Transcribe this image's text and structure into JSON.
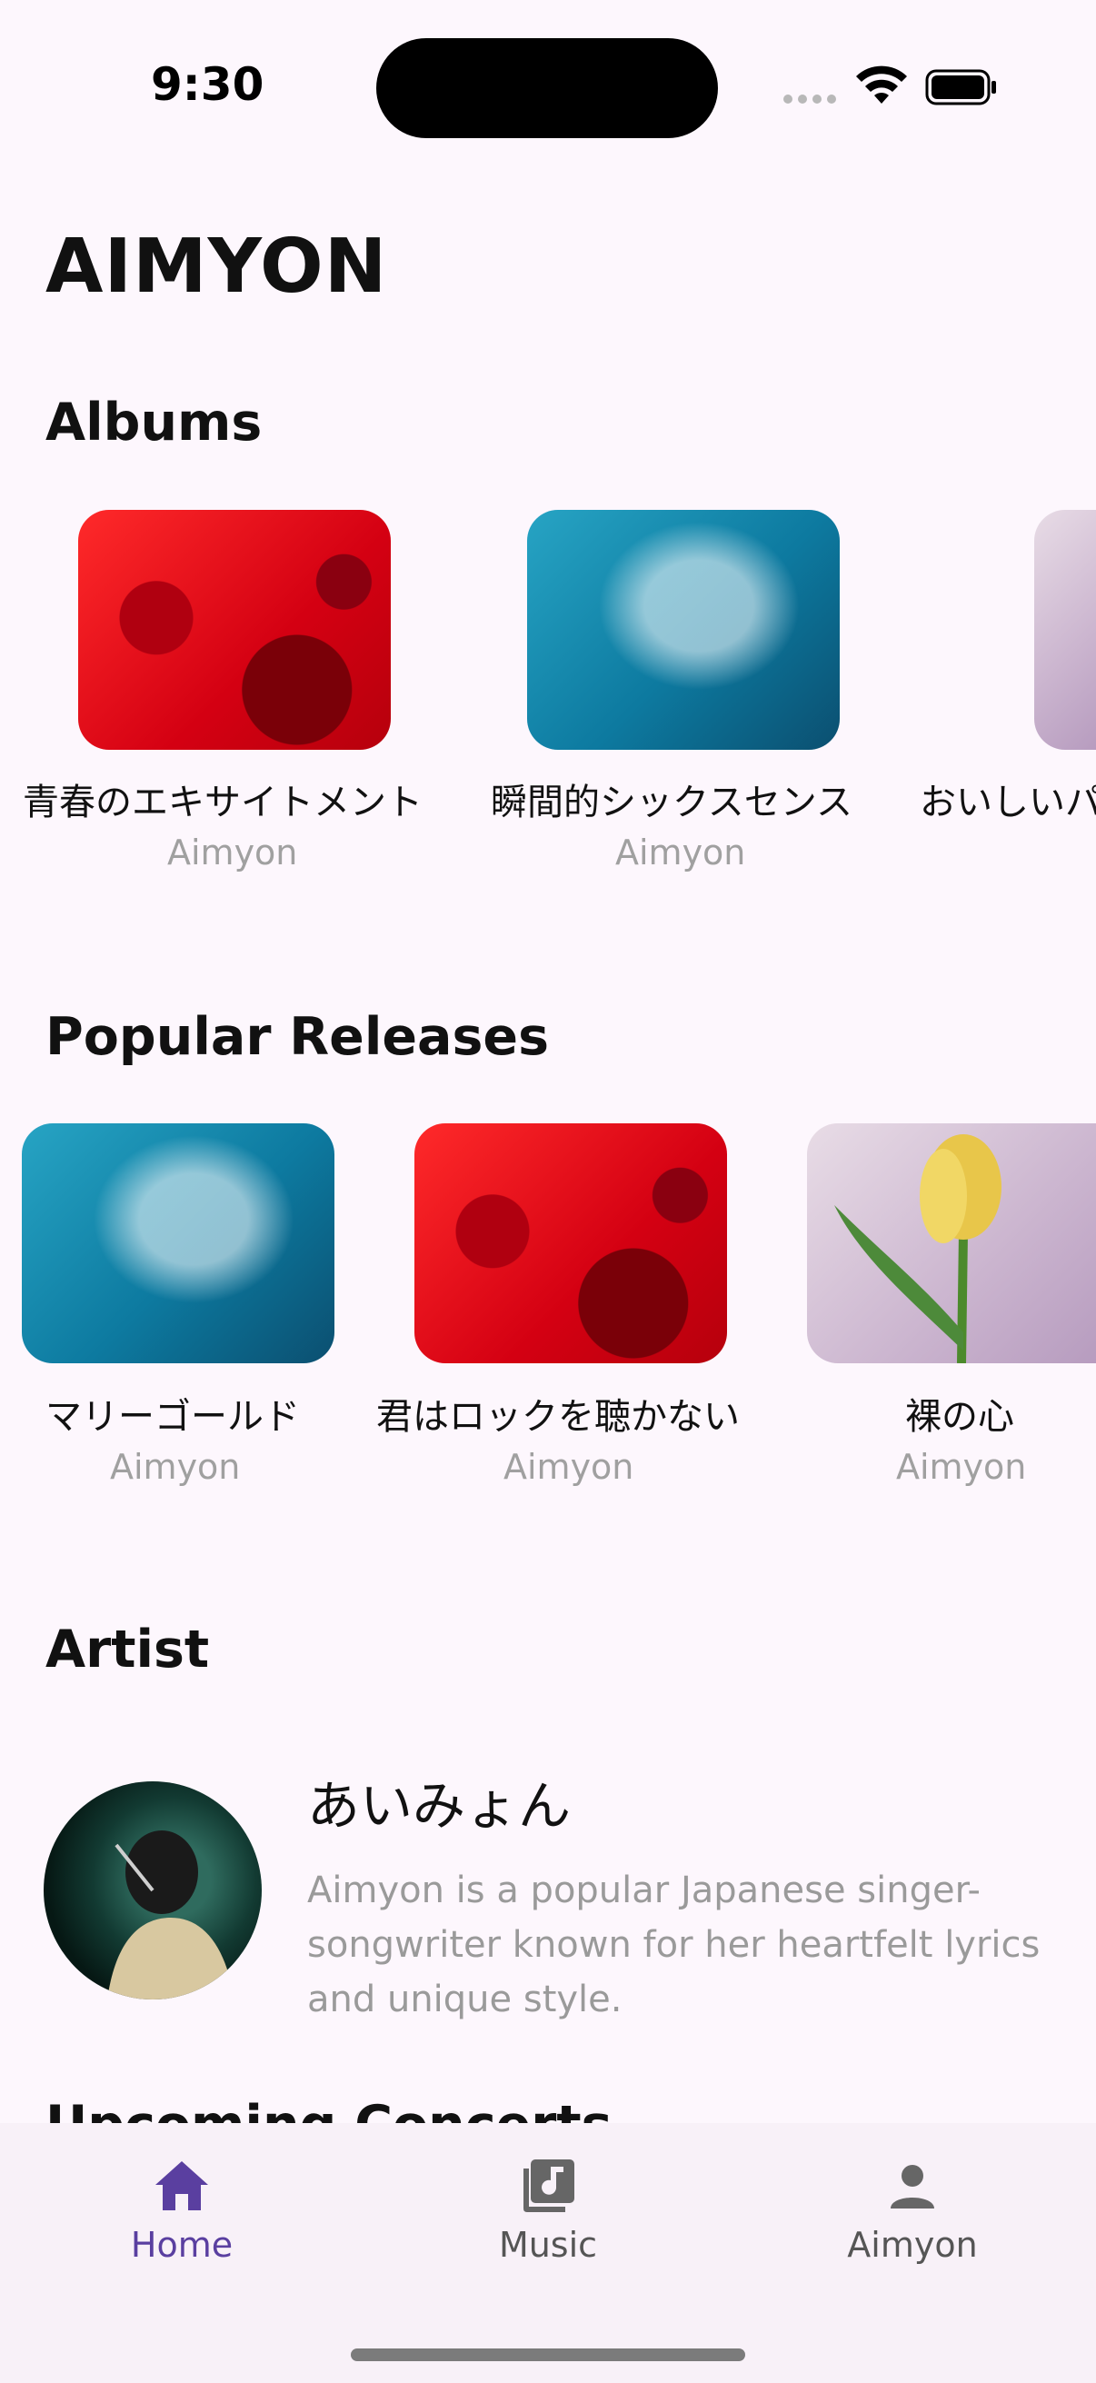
{
  "status_bar": {
    "time": "9:30"
  },
  "app_title": "AIMYON",
  "sections": {
    "albums": "Albums",
    "popular": "Popular Releases",
    "artist": "Artist",
    "concerts": "Upcoming Concerts"
  },
  "albums": [
    {
      "title": "青春のエキサイトメント",
      "artist": "Aimyon"
    },
    {
      "title": "瞬間的シックスセンス",
      "artist": "Aimyon"
    },
    {
      "title": "おいしいパ"
    }
  ],
  "popular_releases": [
    {
      "title": "マリーゴールド",
      "artist": "Aimyon"
    },
    {
      "title": "君はロックを聴かない",
      "artist": "Aimyon"
    },
    {
      "title": "裸の心",
      "artist": "Aimyon"
    }
  ],
  "artist": {
    "name": "あいみょん",
    "description": "Aimyon is a popular Japanese singer-songwriter known for her heartfelt lyrics and unique style."
  },
  "nav": {
    "items": [
      {
        "label": "Home",
        "icon": "home-icon",
        "active": true
      },
      {
        "label": "Music",
        "icon": "music-library-icon",
        "active": false
      },
      {
        "label": "Aimyon",
        "icon": "person-icon",
        "active": false
      }
    ],
    "active_color": "#5a3fa0"
  }
}
